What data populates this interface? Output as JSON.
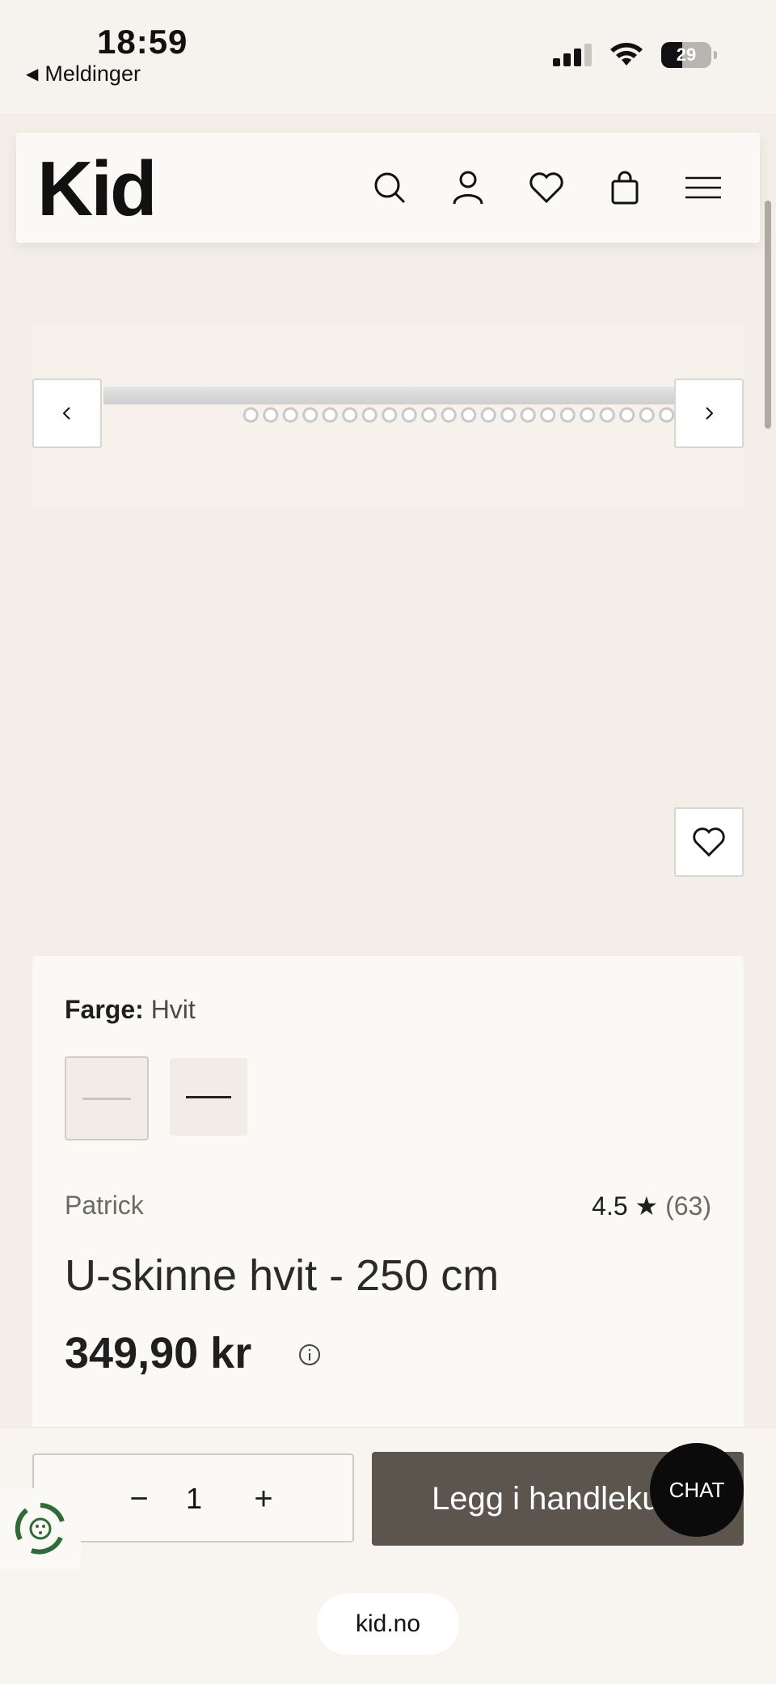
{
  "status_bar": {
    "time": "18:59",
    "back_app_label": "Meldinger",
    "battery_level": "29",
    "icons": [
      "signal-icon",
      "wifi-icon",
      "battery-icon"
    ]
  },
  "header": {
    "logo": "Kid",
    "icons": [
      "search-icon",
      "account-icon",
      "wishlist-icon",
      "cart-icon",
      "menu-icon"
    ]
  },
  "gallery": {
    "prev_icon": "chevron-left-icon",
    "next_icon": "chevron-right-icon",
    "wishlist_icon": "heart-icon"
  },
  "product": {
    "color_label": "Farge:",
    "color_value": "Hvit",
    "swatches": [
      "Hvit",
      "Sort"
    ],
    "selected_swatch": "Hvit",
    "brand": "Patrick",
    "rating": "4.5 ★",
    "review_count": "(63)",
    "title": "U-skinne hvit - 250 cm",
    "price": "349,90 kr"
  },
  "purchase": {
    "quantity": "1",
    "minus": "−",
    "plus": "+",
    "add_to_cart_label": "Legg i handlekurv"
  },
  "chat": {
    "label": "CHAT"
  },
  "browser": {
    "url": "kid.no"
  },
  "colors": {
    "page_bg": "#f3efe8",
    "card_bg": "#fbf9f5",
    "cart_button": "#5c554e",
    "chat_button": "#0b0b0b",
    "recycle_green": "#2f6b35"
  }
}
